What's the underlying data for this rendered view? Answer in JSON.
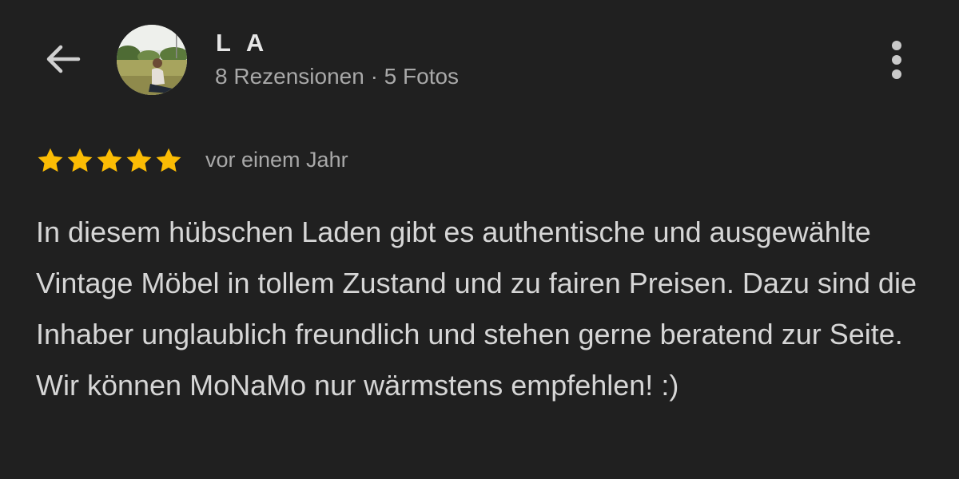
{
  "header": {
    "user_name": "L A",
    "user_meta": "8 Rezensionen · 5 Fotos",
    "back_icon": "arrow-left-icon",
    "more_icon": "more-vertical-icon"
  },
  "review": {
    "rating": 5,
    "rating_max": 5,
    "date": "vor einem Jahr",
    "text": "In diesem hübschen Laden gibt es authentische und ausgewählte Vintage Möbel in tollem Zustand und zu fairen Preisen. Dazu sind die Inhaber unglaublich freundlich und stehen gerne beratend zur Seite. Wir können MoNaMo nur wärmstens empfehlen! :)"
  },
  "colors": {
    "background": "#202020",
    "star": "#fbbc04",
    "primary_text": "#e3e3e3",
    "secondary_text": "#a9a9a9"
  }
}
